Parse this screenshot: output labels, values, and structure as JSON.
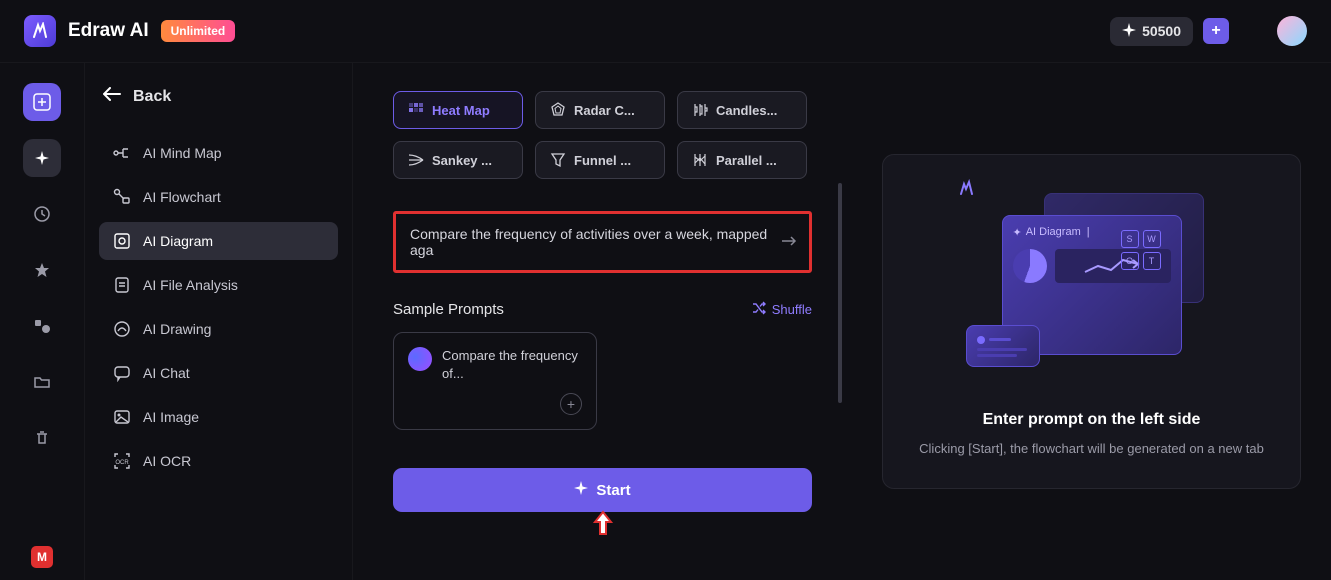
{
  "header": {
    "brand": "Edraw AI",
    "badge": "Unlimited",
    "credits": "50500"
  },
  "leftrail": {
    "badge": "M"
  },
  "sidebar": {
    "back_label": "Back",
    "items": [
      {
        "label": "AI Mind Map"
      },
      {
        "label": "AI Flowchart"
      },
      {
        "label": "AI Diagram"
      },
      {
        "label": "AI File Analysis"
      },
      {
        "label": "AI Drawing"
      },
      {
        "label": "AI Chat"
      },
      {
        "label": "AI Image"
      },
      {
        "label": "AI OCR"
      }
    ]
  },
  "chips": [
    {
      "label": "Heat Map"
    },
    {
      "label": "Radar C..."
    },
    {
      "label": "Candles..."
    },
    {
      "label": "Sankey ..."
    },
    {
      "label": "Funnel ..."
    },
    {
      "label": "Parallel ..."
    }
  ],
  "prompt": {
    "text": "Compare the frequency of activities over a week, mapped aga"
  },
  "samples": {
    "title": "Sample Prompts",
    "shuffle_label": "Shuffle",
    "item_text": "Compare the frequency of..."
  },
  "start_label": "Start",
  "preview": {
    "ill_label": "AI Diagram",
    "grid": [
      "S",
      "W",
      "O",
      "T"
    ],
    "title": "Enter prompt on the left side",
    "desc": "Clicking [Start], the flowchart will be generated on a new tab"
  }
}
